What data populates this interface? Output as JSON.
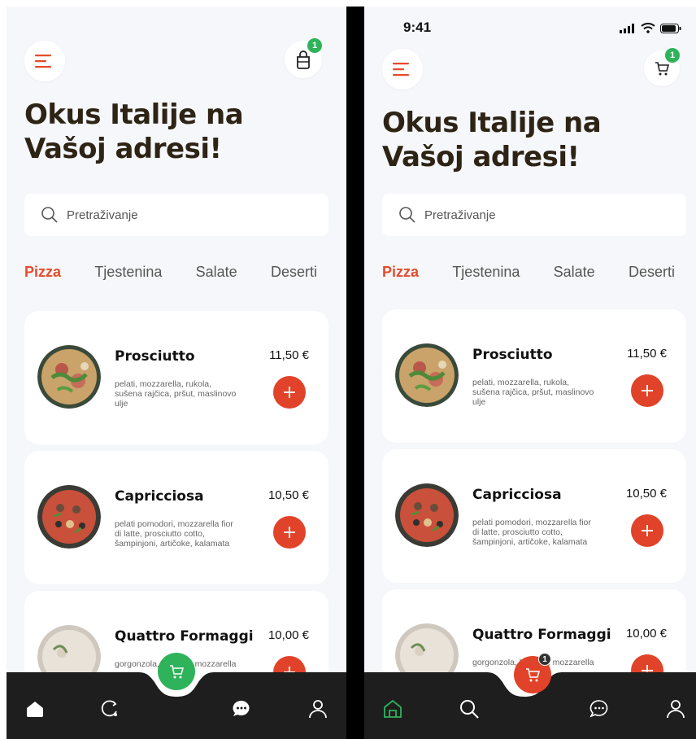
{
  "status_bar": {
    "time": "9:41"
  },
  "header": {
    "cart_badge": "1"
  },
  "headline": "Okus Italije na Vašoj adresi!",
  "search": {
    "placeholder": "Pretraživanje"
  },
  "tabs": [
    {
      "label": "Pizza",
      "active": true
    },
    {
      "label": "Tjestenina",
      "active": false
    },
    {
      "label": "Salate",
      "active": false
    },
    {
      "label": "Deserti",
      "active": false
    }
  ],
  "products": [
    {
      "name": "Prosciutto",
      "price": "11,50 €",
      "description": "pelati, mozzarella, rukola, sušena rajčica, pršut, maslinovo ulje"
    },
    {
      "name": "Capricciosa",
      "price": "10,50 €",
      "description": "pelati pomodori, mozzarella fior di latte, prosciutto cotto, šampinjoni, artičoke, kalamata"
    },
    {
      "name": "Quattro Formaggi",
      "price": "10,00 €",
      "description": "gorgonzola, bosiljak, mozzarella"
    }
  ],
  "nav": {
    "cart_badge": "1"
  },
  "colors": {
    "accent": "#e04329",
    "green": "#2fb35a",
    "nav_bg": "#1e1e1e",
    "heading": "#2d2416"
  }
}
